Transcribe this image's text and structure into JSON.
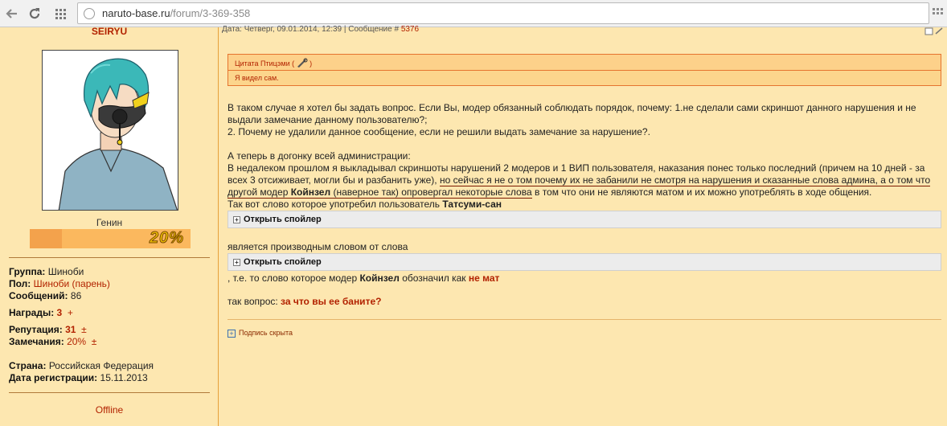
{
  "browser": {
    "url_domain": "naruto-base.ru",
    "url_path": "/forum/3-369-358"
  },
  "user": {
    "username": "SEIRYU",
    "rank": "Генин",
    "rank_progress_percent": 20,
    "rank_progress_label": "20%",
    "group_label": "Группа:",
    "group": "Шиноби",
    "gender_label": "Пол:",
    "gender": "Шиноби (парень)",
    "messages_label": "Сообщений:",
    "messages": "86",
    "awards_label": "Награды:",
    "awards": "3",
    "awards_plus": "+",
    "reputation_label": "Репутация:",
    "reputation": "31",
    "reputation_pm": "±",
    "warnings_label": "Замечания:",
    "warnings": "20%",
    "warnings_pm": "±",
    "country_label": "Страна:",
    "country": "Российская Федерация",
    "registered_label": "Дата регистрации:",
    "registered": "15.11.2013",
    "status": "Offline"
  },
  "post": {
    "header_prefix": "Дата: Четверг, 09.01.2014, 12:39 | Сообщение #",
    "message_number": "5376",
    "quote_title": "Цитата Птицэми (",
    "quote_title_end": ")",
    "quote_text": "Я видел сам.",
    "para1": "В таком случае я хотел бы задать вопрос. Если Вы, модер обязанный соблюдать порядок, почему: 1.не сделали сами скриншот данного нарушения и не выдали замечание данному пользователю?;",
    "para2": "2. Почему не удалили данное сообщение, если не решили выдать замечание за нарушение?.",
    "para3": "А теперь в догонку всей администрации:",
    "para4_a": "В недалеком прошлом я выкладывал скриншоты нарушений 2 модеров и 1 ВИП пользователя, наказания понес только последний (причем на 10 дней - за всех 3 отсиживает, могли бы и разбанить уже), ",
    "para4_u1": "но сейчас я не о том почему их не забанили не смотря на нарушения и сказанные слова админа, а о том что другой модер ",
    "para4_b": "Койнзел",
    "para4_u2": " (наверное так) опровергал некоторые слова",
    "para4_c": " в том что они не являются матом и их можно употреблять в ходе общения.",
    "para5": "Так вот слово которое употребил пользователь ",
    "para5_b": "Татсуми-сан",
    "spoiler_label": "Открыть спойлер",
    "para6": "является производным словом от слова",
    "spoiler2_label": "Открыть спойлер",
    "para7": ", т.е. то слово которое модер ",
    "para7_b": "Койнзел",
    "para7_c": " обозначил как ",
    "para7_red": "не мат",
    "para8": "так вопрос: ",
    "para8_red": "за что вы ее баните?",
    "signature_label": "Подпись скрыта"
  },
  "icons": {
    "back": "back-arrow-icon",
    "reload": "reload-icon",
    "apps": "apps-grid-icon",
    "page": "page-info-icon"
  }
}
